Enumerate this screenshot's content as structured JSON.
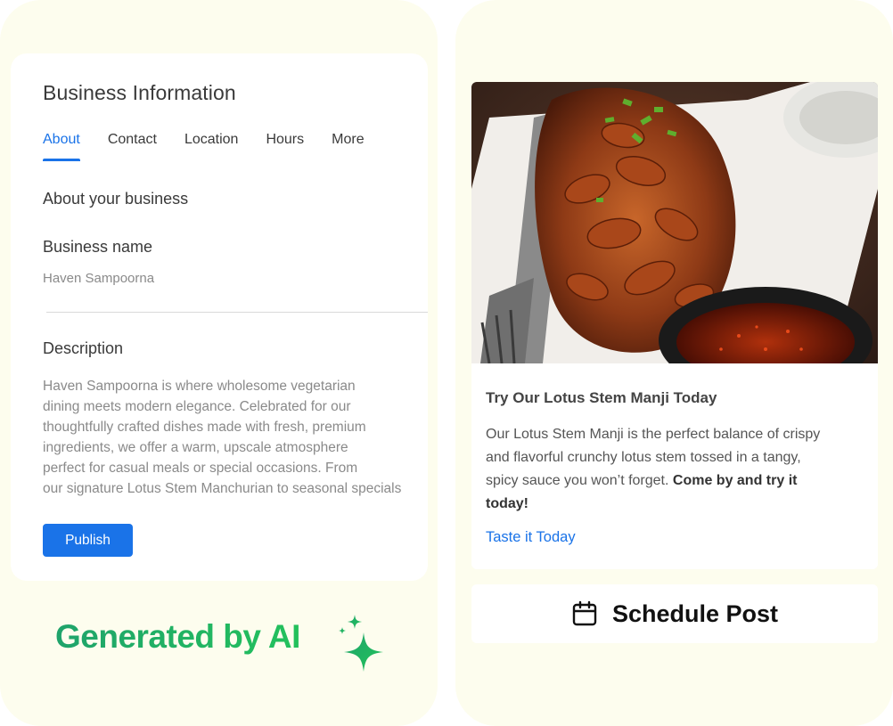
{
  "business_info": {
    "title": "Business Information",
    "tabs": [
      {
        "label": "About",
        "active": true
      },
      {
        "label": "Contact",
        "active": false
      },
      {
        "label": "Location",
        "active": false
      },
      {
        "label": "Hours",
        "active": false
      },
      {
        "label": "More",
        "active": false
      }
    ],
    "section_heading": "About your business",
    "business_name_label": "Business name",
    "business_name_value": "Haven Sampoorna",
    "description_label": "Description",
    "description_lines": [
      "Haven Sampoorna is where wholesome vegetarian",
      "dining meets modern elegance. Celebrated for our",
      "thoughtfully crafted dishes made with fresh, premium",
      "ingredients, we offer a warm, upscale atmosphere",
      "perfect for casual meals or special occasions. From",
      "our signature Lotus Stem Manchurian to seasonal specials"
    ],
    "publish_label": "Publish"
  },
  "badge": {
    "text": "Generated by AI",
    "icon": "sparkle-icon"
  },
  "post": {
    "image_alt": "Plate of Lotus Stem Manji with dipping sauce and fork",
    "title": "Try Our Lotus Stem Manji Today",
    "body_lines": [
      "Our Lotus Stem Manji is the perfect balance of crispy",
      "and flavorful crunchy lotus stem tossed in a tangy,",
      "spicy sauce you won’t forget."
    ],
    "body_bold_1": "Come by and try it",
    "body_bold_2": "today!",
    "link_label": "Taste it Today"
  },
  "schedule": {
    "label": "Schedule Post",
    "icon": "calendar-icon"
  },
  "colors": {
    "panel_bg": "#fdfdee",
    "accent_blue": "#1a73e8",
    "ai_green": "#1fb36b"
  }
}
